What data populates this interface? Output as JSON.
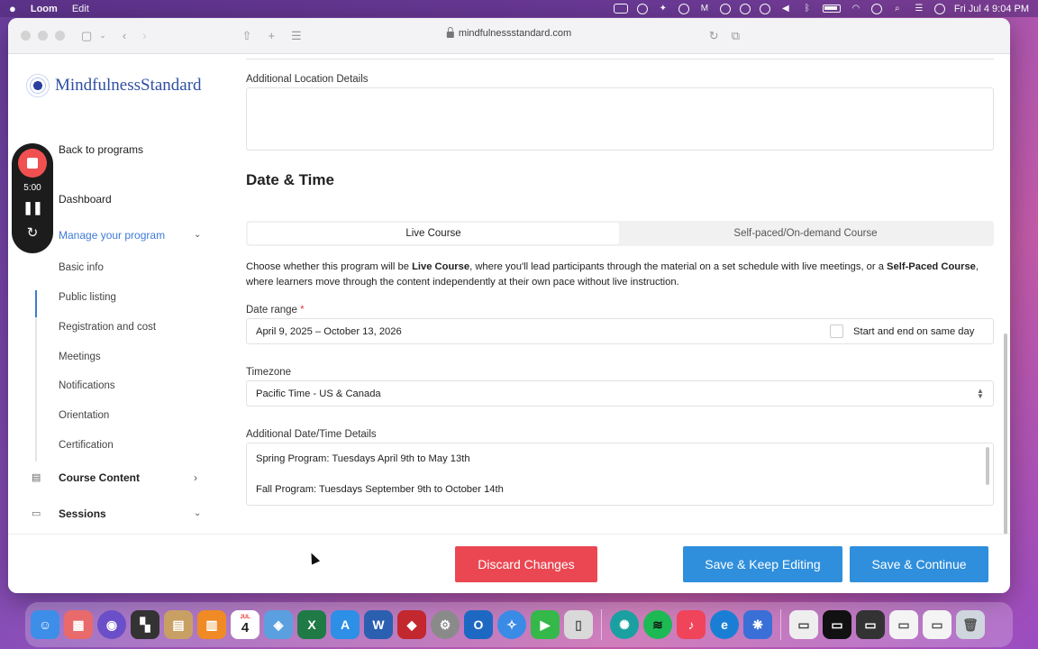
{
  "menubar": {
    "app_name": "Loom",
    "menu_edit": "Edit",
    "clock": "Fri Jul 4  9:04 PM"
  },
  "browser": {
    "url": "mindfulnessstandard.com"
  },
  "brand": {
    "logo_text": "MindfulnessStandard",
    "accent": "#3f7bd8"
  },
  "loom": {
    "timer": "5:00"
  },
  "sidebar": {
    "back": "Back to programs",
    "dashboard": "Dashboard",
    "manage": "Manage your program",
    "sub_items": [
      "Basic info",
      "Public listing",
      "Registration and cost",
      "Meetings",
      "Notifications",
      "Orientation",
      "Certification"
    ],
    "course_content": "Course Content",
    "sessions": "Sessions"
  },
  "form": {
    "additional_location_label": "Additional Location Details",
    "additional_location_value": "",
    "section_title": "Date & Time",
    "tab_live": "Live Course",
    "tab_self": "Self-paced/On-demand Course",
    "desc_1": "Choose whether this program will be ",
    "desc_live": "Live Course",
    "desc_2": ", where you'll lead participants through the material on a set schedule with live meetings, or a ",
    "desc_self": "Self-Paced Course",
    "desc_3": ", where learners move through the content independently at their own pace without live instruction.",
    "date_range_label": "Date range",
    "date_range_required": "*",
    "date_range_value": "April 9, 2025 – October 13, 2026",
    "same_day_label": "Start and end on same day",
    "timezone_label": "Timezone",
    "timezone_value": "Pacific Time - US & Canada",
    "datetime_details_label": "Additional Date/Time Details",
    "datetime_line_1": "Spring Program: Tuesdays April 9th to May 13th",
    "datetime_line_2": "Fall Program: Tuesdays September 9th to October 14th"
  },
  "footer": {
    "discard": "Discard Changes",
    "save_keep": "Save & Keep Editing",
    "save_continue": "Save & Continue",
    "discard_color": "#ea4753",
    "save_color": "#2f8fdc"
  },
  "dock": {
    "calendar_month": "JUL",
    "calendar_day": "4"
  }
}
